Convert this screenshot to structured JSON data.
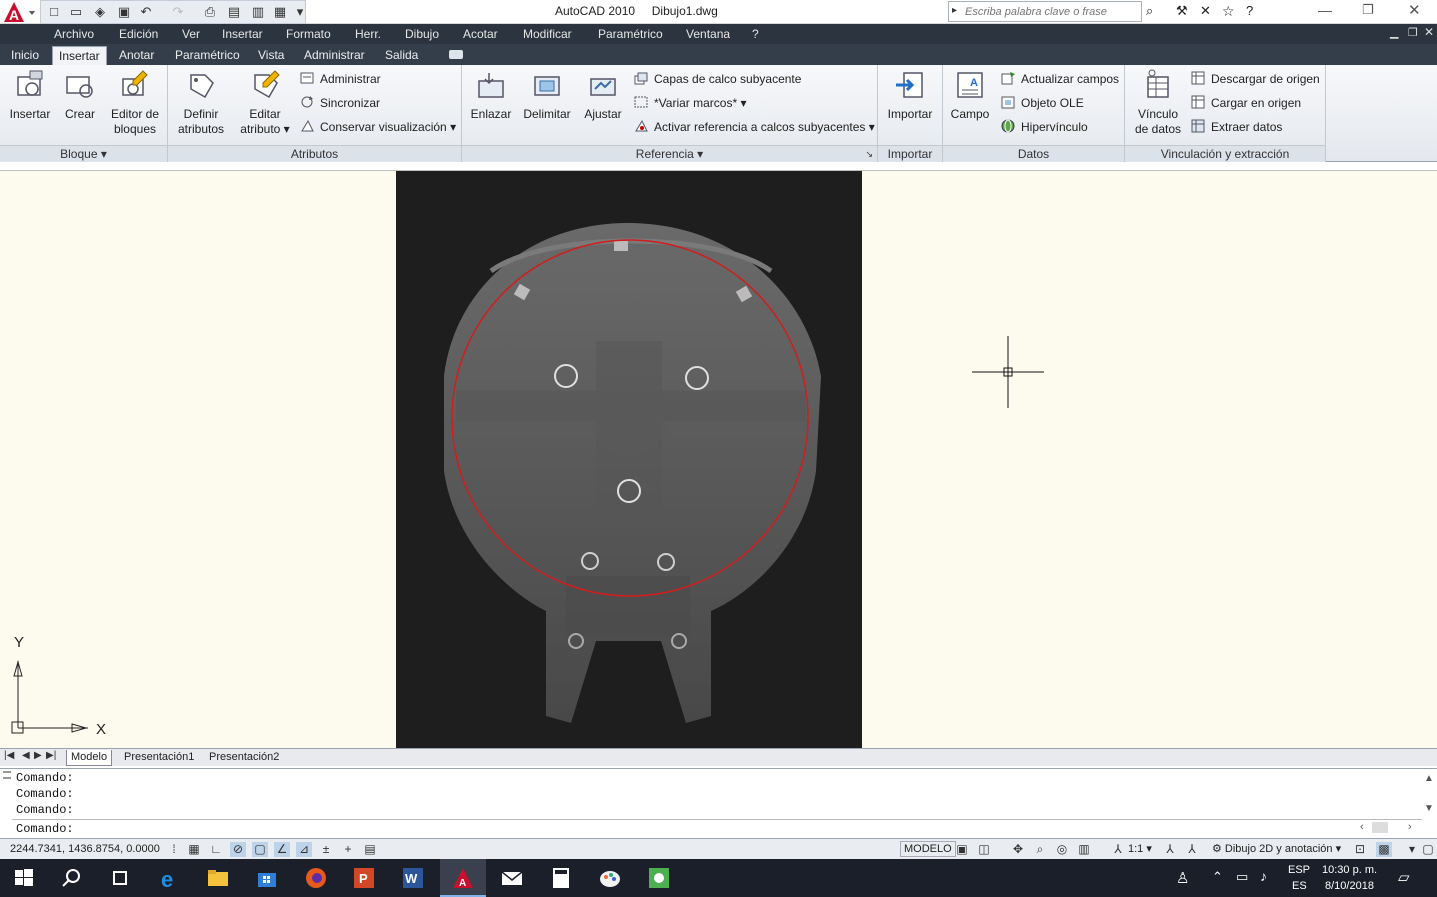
{
  "window": {
    "app_title": "AutoCAD 2010",
    "doc_title": "Dibujo1.dwg",
    "search_placeholder": "Escriba palabra clave o frase"
  },
  "menu": [
    "Archivo",
    "Edición",
    "Ver",
    "Insertar",
    "Formato",
    "Herr.",
    "Dibujo",
    "Acotar",
    "Modificar",
    "Paramétrico",
    "Ventana",
    "?"
  ],
  "tabs": [
    "Inicio",
    "Insertar",
    "Anotar",
    "Paramétrico",
    "Vista",
    "Administrar",
    "Salida"
  ],
  "ribbon": {
    "bloque": {
      "label": "Bloque",
      "insertar": "Insertar",
      "crear": "Crear",
      "editor1": "Editor de",
      "editor2": "bloques"
    },
    "atributos": {
      "label": "Atributos",
      "definir1": "Definir",
      "definir2": "atributos",
      "editar1": "Editar",
      "editar2": "atributo",
      "administrar": "Administrar",
      "sincronizar": "Sincronizar",
      "conservar": "Conservar visualización"
    },
    "referencia": {
      "label": "Referencia",
      "enlazar": "Enlazar",
      "delimitar": "Delimitar",
      "ajustar": "Ajustar",
      "capas": "Capas de calco subyacente",
      "variar": "*Variar marcos*",
      "activar": "Activar referencia a calcos subyacentes"
    },
    "importar": {
      "label": "Importar",
      "importar": "Importar"
    },
    "datos": {
      "label": "Datos",
      "campo": "Campo",
      "actualizar": "Actualizar campos",
      "ole": "Objeto OLE",
      "hipervinculo": "Hipervínculo"
    },
    "vinculacion": {
      "label": "Vinculación y extracción",
      "vinculo1": "Vínculo",
      "vinculo2": "de datos",
      "descargar": "Descargar de origen",
      "cargar": "Cargar en origen",
      "extraer": "Extraer  datos"
    }
  },
  "ucs": {
    "y": "Y",
    "x": "X"
  },
  "layout_tabs": [
    "Modelo",
    "Presentación1",
    "Presentación2"
  ],
  "command_lines": [
    "Comando:",
    "Comando:",
    "Comando:"
  ],
  "command_prompt": "Comando:",
  "status": {
    "coords": "2244.7341, 1436.8754, 0.0000",
    "modelo": "MODELO",
    "scale": "1:1",
    "workspace": "Dibujo 2D y anotación"
  },
  "taskbar": {
    "lang1": "ESP",
    "lang2": "ES",
    "time": "10:30 p. m.",
    "date": "8/10/2018"
  },
  "colors": {
    "menubar": "#2c3440",
    "canvas": "#fdfbee",
    "circle": "#d21d1d",
    "taskbar": "#1b1f2a"
  }
}
